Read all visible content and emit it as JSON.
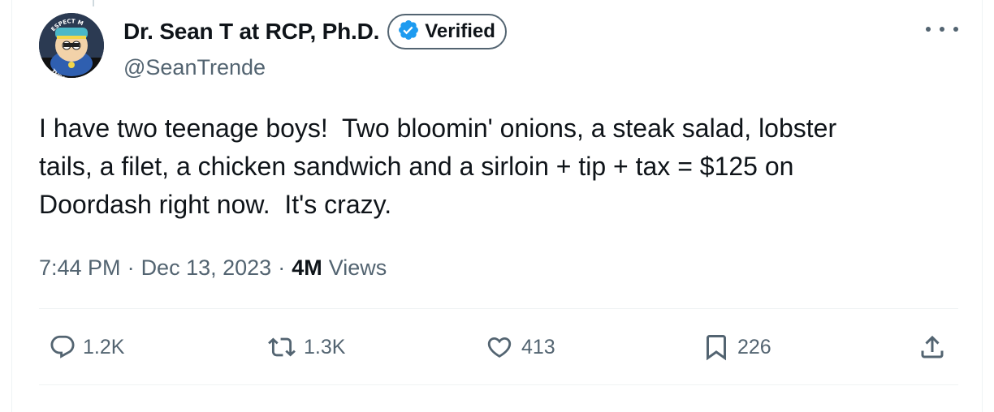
{
  "author": {
    "display_name": "Dr. Sean T at RCP, Ph.D.",
    "handle": "@SeanTrende",
    "verified_label": "Verified",
    "avatar_text_top": "ESPECT M",
    "avatar_text_bottom": "THORITA"
  },
  "tweet": {
    "text": "I have two teenage boys!  Two bloomin' onions, a steak salad, lobster\ntails, a filet, a chicken sandwich and a sirloin + tip + tax = $125 on\nDoordash right now.  It's crazy.",
    "time": "7:44 PM",
    "date": "Dec 13, 2023",
    "separator": "·",
    "views_count": "4M",
    "views_label": "Views"
  },
  "actions": {
    "replies": "1.2K",
    "reposts": "1.3K",
    "likes": "413",
    "bookmarks": "226"
  },
  "colors": {
    "text": "#0f1419",
    "secondary": "#536471",
    "verified_blue": "#1d9bf0",
    "divider": "#eff3f4"
  },
  "icons": [
    "reply-icon",
    "repost-icon",
    "like-icon",
    "bookmark-icon",
    "share-icon",
    "verified-badge-icon",
    "more-icon"
  ]
}
